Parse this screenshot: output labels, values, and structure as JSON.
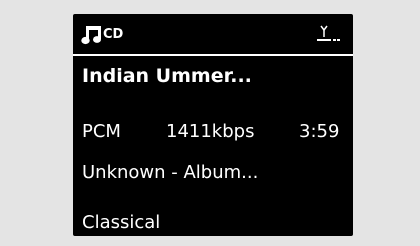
{
  "header": {
    "source": "CD",
    "source_icon": "music-note-icon",
    "status_icon": "signal-antenna-icon"
  },
  "track": {
    "title": "Indian Ummer...",
    "format": "PCM",
    "bitrate": "1411kbps",
    "duration": "3:59",
    "artist_album": "Unknown - Album...",
    "genre": "Classical"
  },
  "colors": {
    "screen_bg": "#000000",
    "text": "#ffffff",
    "frame_bg": "#e4e4e4"
  }
}
